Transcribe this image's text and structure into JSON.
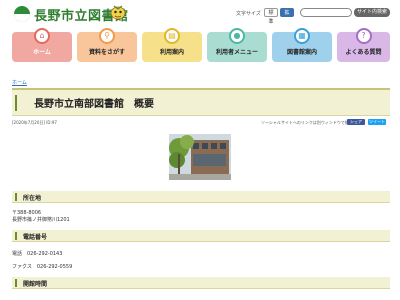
{
  "header": {
    "site_title": "長野市立図書館",
    "font_size_label": "文字サイズ",
    "font_size_standard": "標準",
    "font_size_large": "拡大",
    "search_placeholder": "",
    "search_button": "サイト内検索"
  },
  "nav": {
    "items": [
      {
        "label": "ホーム",
        "icon": "home-icon"
      },
      {
        "label": "資料をさがす",
        "icon": "search-icon"
      },
      {
        "label": "利用案内",
        "icon": "book-icon"
      },
      {
        "label": "利用者メニュー",
        "icon": "user-icon"
      },
      {
        "label": "図書館案内",
        "icon": "building-icon"
      },
      {
        "label": "よくある質問",
        "icon": "question-icon"
      }
    ]
  },
  "breadcrumb": "ホーム",
  "page": {
    "title": "長野市立南部図書館　概要",
    "updated": "[2020年7月20日] ID:97",
    "external_note": "ソーシャルサイトへのリンクは別ウィンドウで開きます",
    "share_facebook": "シェア",
    "share_twitter": "ツイート"
  },
  "sections": {
    "location": {
      "heading": "所在地",
      "postal": "〒388-8006",
      "address": "長野市篠ノ井御幣川1201"
    },
    "phone": {
      "heading": "電話番号",
      "tel": "電話　026-292-0143",
      "fax": "ファクス　026-292-0559"
    },
    "hours": {
      "heading": "開館時間"
    }
  },
  "colors": {
    "brand_green": "#2f7d2f",
    "nav_home": "#f0a8a0",
    "nav_search": "#f8c69a",
    "nav_guide": "#f6e08a",
    "nav_menu": "#a9ddd2",
    "nav_info": "#9fd0ec",
    "nav_faq": "#d9b8e8",
    "section_bg": "#f3f1d4"
  }
}
